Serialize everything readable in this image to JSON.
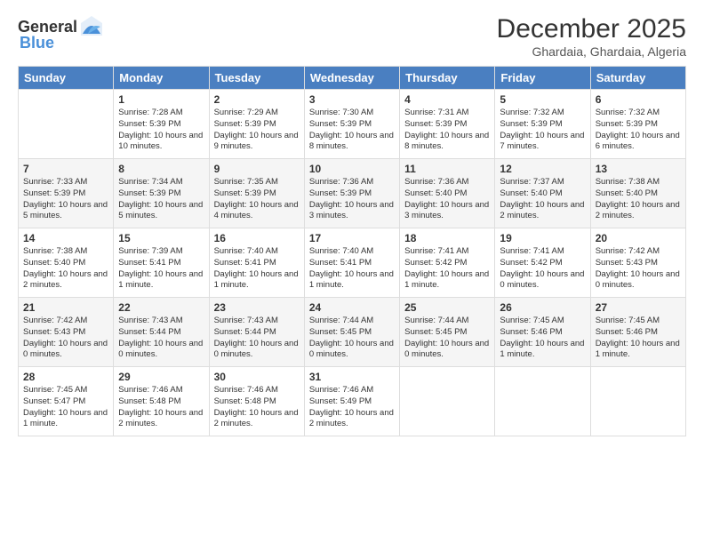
{
  "logo": {
    "general": "General",
    "blue": "Blue"
  },
  "title": "December 2025",
  "subtitle": "Ghardaia, Ghardaia, Algeria",
  "days_header": [
    "Sunday",
    "Monday",
    "Tuesday",
    "Wednesday",
    "Thursday",
    "Friday",
    "Saturday"
  ],
  "weeks": [
    [
      {
        "day": "",
        "sunrise": "",
        "sunset": "",
        "daylight": ""
      },
      {
        "day": "1",
        "sunrise": "Sunrise: 7:28 AM",
        "sunset": "Sunset: 5:39 PM",
        "daylight": "Daylight: 10 hours and 10 minutes."
      },
      {
        "day": "2",
        "sunrise": "Sunrise: 7:29 AM",
        "sunset": "Sunset: 5:39 PM",
        "daylight": "Daylight: 10 hours and 9 minutes."
      },
      {
        "day": "3",
        "sunrise": "Sunrise: 7:30 AM",
        "sunset": "Sunset: 5:39 PM",
        "daylight": "Daylight: 10 hours and 8 minutes."
      },
      {
        "day": "4",
        "sunrise": "Sunrise: 7:31 AM",
        "sunset": "Sunset: 5:39 PM",
        "daylight": "Daylight: 10 hours and 8 minutes."
      },
      {
        "day": "5",
        "sunrise": "Sunrise: 7:32 AM",
        "sunset": "Sunset: 5:39 PM",
        "daylight": "Daylight: 10 hours and 7 minutes."
      },
      {
        "day": "6",
        "sunrise": "Sunrise: 7:32 AM",
        "sunset": "Sunset: 5:39 PM",
        "daylight": "Daylight: 10 hours and 6 minutes."
      }
    ],
    [
      {
        "day": "7",
        "sunrise": "Sunrise: 7:33 AM",
        "sunset": "Sunset: 5:39 PM",
        "daylight": "Daylight: 10 hours and 5 minutes."
      },
      {
        "day": "8",
        "sunrise": "Sunrise: 7:34 AM",
        "sunset": "Sunset: 5:39 PM",
        "daylight": "Daylight: 10 hours and 5 minutes."
      },
      {
        "day": "9",
        "sunrise": "Sunrise: 7:35 AM",
        "sunset": "Sunset: 5:39 PM",
        "daylight": "Daylight: 10 hours and 4 minutes."
      },
      {
        "day": "10",
        "sunrise": "Sunrise: 7:36 AM",
        "sunset": "Sunset: 5:39 PM",
        "daylight": "Daylight: 10 hours and 3 minutes."
      },
      {
        "day": "11",
        "sunrise": "Sunrise: 7:36 AM",
        "sunset": "Sunset: 5:40 PM",
        "daylight": "Daylight: 10 hours and 3 minutes."
      },
      {
        "day": "12",
        "sunrise": "Sunrise: 7:37 AM",
        "sunset": "Sunset: 5:40 PM",
        "daylight": "Daylight: 10 hours and 2 minutes."
      },
      {
        "day": "13",
        "sunrise": "Sunrise: 7:38 AM",
        "sunset": "Sunset: 5:40 PM",
        "daylight": "Daylight: 10 hours and 2 minutes."
      }
    ],
    [
      {
        "day": "14",
        "sunrise": "Sunrise: 7:38 AM",
        "sunset": "Sunset: 5:40 PM",
        "daylight": "Daylight: 10 hours and 2 minutes."
      },
      {
        "day": "15",
        "sunrise": "Sunrise: 7:39 AM",
        "sunset": "Sunset: 5:41 PM",
        "daylight": "Daylight: 10 hours and 1 minute."
      },
      {
        "day": "16",
        "sunrise": "Sunrise: 7:40 AM",
        "sunset": "Sunset: 5:41 PM",
        "daylight": "Daylight: 10 hours and 1 minute."
      },
      {
        "day": "17",
        "sunrise": "Sunrise: 7:40 AM",
        "sunset": "Sunset: 5:41 PM",
        "daylight": "Daylight: 10 hours and 1 minute."
      },
      {
        "day": "18",
        "sunrise": "Sunrise: 7:41 AM",
        "sunset": "Sunset: 5:42 PM",
        "daylight": "Daylight: 10 hours and 1 minute."
      },
      {
        "day": "19",
        "sunrise": "Sunrise: 7:41 AM",
        "sunset": "Sunset: 5:42 PM",
        "daylight": "Daylight: 10 hours and 0 minutes."
      },
      {
        "day": "20",
        "sunrise": "Sunrise: 7:42 AM",
        "sunset": "Sunset: 5:43 PM",
        "daylight": "Daylight: 10 hours and 0 minutes."
      }
    ],
    [
      {
        "day": "21",
        "sunrise": "Sunrise: 7:42 AM",
        "sunset": "Sunset: 5:43 PM",
        "daylight": "Daylight: 10 hours and 0 minutes."
      },
      {
        "day": "22",
        "sunrise": "Sunrise: 7:43 AM",
        "sunset": "Sunset: 5:44 PM",
        "daylight": "Daylight: 10 hours and 0 minutes."
      },
      {
        "day": "23",
        "sunrise": "Sunrise: 7:43 AM",
        "sunset": "Sunset: 5:44 PM",
        "daylight": "Daylight: 10 hours and 0 minutes."
      },
      {
        "day": "24",
        "sunrise": "Sunrise: 7:44 AM",
        "sunset": "Sunset: 5:45 PM",
        "daylight": "Daylight: 10 hours and 0 minutes."
      },
      {
        "day": "25",
        "sunrise": "Sunrise: 7:44 AM",
        "sunset": "Sunset: 5:45 PM",
        "daylight": "Daylight: 10 hours and 0 minutes."
      },
      {
        "day": "26",
        "sunrise": "Sunrise: 7:45 AM",
        "sunset": "Sunset: 5:46 PM",
        "daylight": "Daylight: 10 hours and 1 minute."
      },
      {
        "day": "27",
        "sunrise": "Sunrise: 7:45 AM",
        "sunset": "Sunset: 5:46 PM",
        "daylight": "Daylight: 10 hours and 1 minute."
      }
    ],
    [
      {
        "day": "28",
        "sunrise": "Sunrise: 7:45 AM",
        "sunset": "Sunset: 5:47 PM",
        "daylight": "Daylight: 10 hours and 1 minute."
      },
      {
        "day": "29",
        "sunrise": "Sunrise: 7:46 AM",
        "sunset": "Sunset: 5:48 PM",
        "daylight": "Daylight: 10 hours and 2 minutes."
      },
      {
        "day": "30",
        "sunrise": "Sunrise: 7:46 AM",
        "sunset": "Sunset: 5:48 PM",
        "daylight": "Daylight: 10 hours and 2 minutes."
      },
      {
        "day": "31",
        "sunrise": "Sunrise: 7:46 AM",
        "sunset": "Sunset: 5:49 PM",
        "daylight": "Daylight: 10 hours and 2 minutes."
      },
      {
        "day": "",
        "sunrise": "",
        "sunset": "",
        "daylight": ""
      },
      {
        "day": "",
        "sunrise": "",
        "sunset": "",
        "daylight": ""
      },
      {
        "day": "",
        "sunrise": "",
        "sunset": "",
        "daylight": ""
      }
    ]
  ]
}
